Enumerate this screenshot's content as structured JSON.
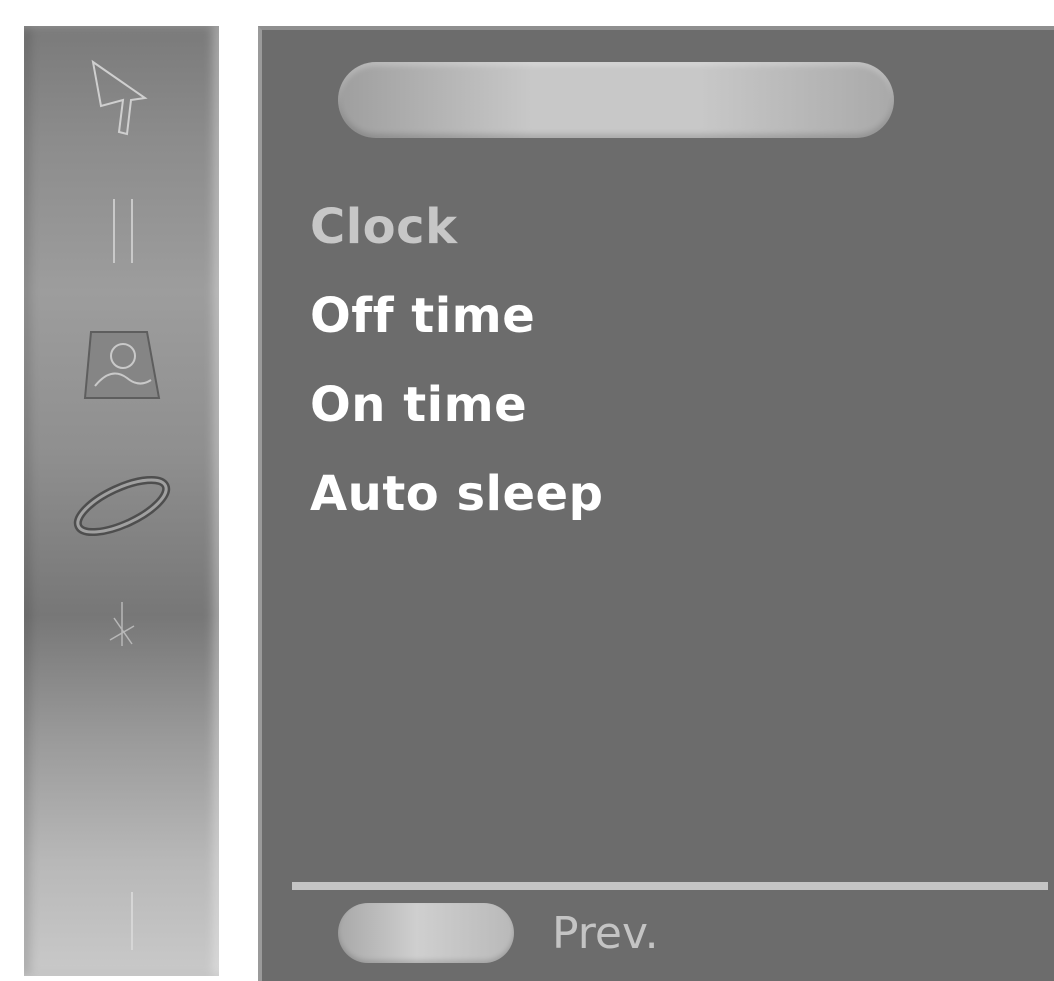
{
  "window": {
    "title": ""
  },
  "sidebar": {
    "icons": [
      {
        "name": "picture-icon"
      },
      {
        "name": "pause-icon"
      },
      {
        "name": "timer-icon"
      },
      {
        "name": "ring-icon"
      },
      {
        "name": "special-icon"
      },
      {
        "name": "screen-icon"
      }
    ]
  },
  "menu": {
    "items": [
      {
        "label": "Clock",
        "selected": true
      },
      {
        "label": "Off time",
        "selected": false
      },
      {
        "label": "On time",
        "selected": false
      },
      {
        "label": "Auto sleep",
        "selected": false
      }
    ]
  },
  "footer": {
    "prev_label": "Prev."
  },
  "colors": {
    "panel_bg": "#6c6c6c",
    "menu_text": "#ffffff",
    "selected_text": "#c7c7c7",
    "pill": "#c8c8c8"
  }
}
